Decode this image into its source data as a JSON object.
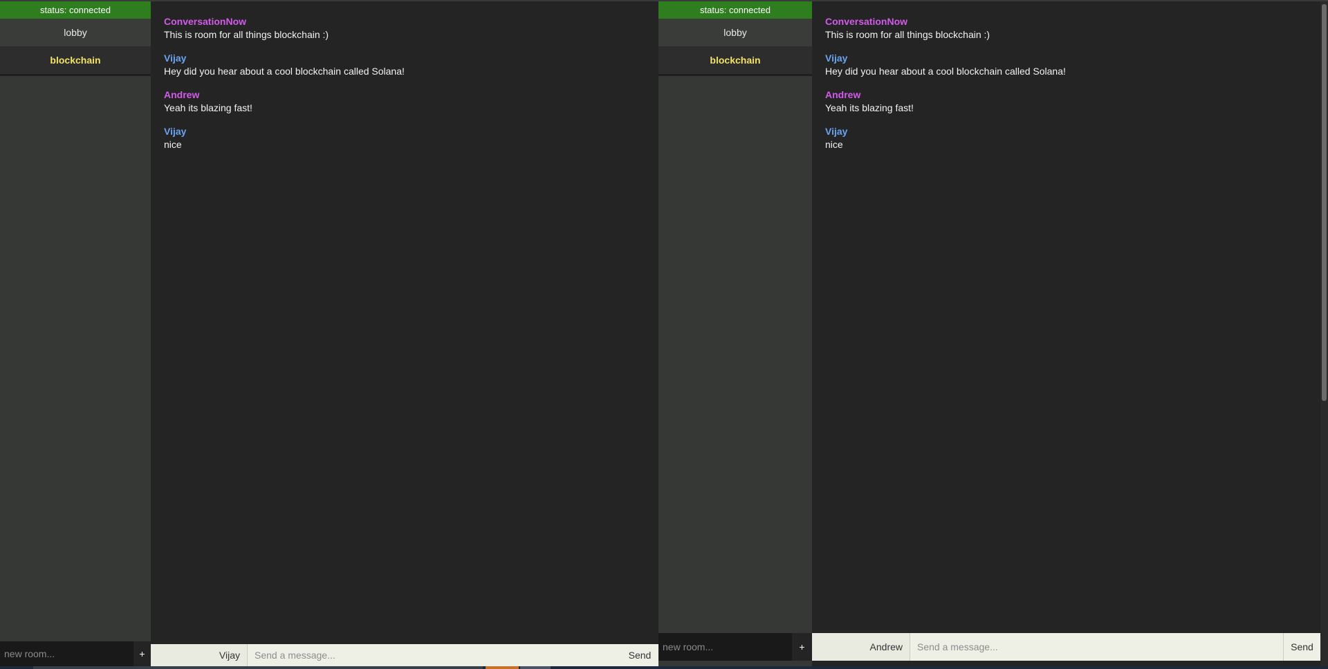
{
  "panes": {
    "left": {
      "status": "status: connected",
      "rooms": [
        {
          "label": "lobby",
          "active": false
        },
        {
          "label": "blockchain",
          "active": true
        }
      ],
      "new_room_placeholder": "new room...",
      "add_room_label": "+",
      "messages": [
        {
          "sender": "ConversationNow",
          "text": "This is room for all things blockchain :)",
          "color": "#d35bea"
        },
        {
          "sender": "Vijay",
          "text": "Hey did you hear about a cool blockchain called Solana!",
          "color": "#6aa4f2"
        },
        {
          "sender": "Andrew",
          "text": "Yeah its blazing fast!",
          "color": "#d35bea"
        },
        {
          "sender": "Vijay",
          "text": "nice",
          "color": "#6aa4f2"
        }
      ],
      "username": "Vijay",
      "message_placeholder": "Send a message...",
      "send_label": "Send"
    },
    "right": {
      "status": "status: connected",
      "rooms": [
        {
          "label": "lobby",
          "active": false
        },
        {
          "label": "blockchain",
          "active": true
        }
      ],
      "new_room_placeholder": "new room...",
      "add_room_label": "+",
      "messages": [
        {
          "sender": "ConversationNow",
          "text": "This is room for all things blockchain :)",
          "color": "#d35bea"
        },
        {
          "sender": "Vijay",
          "text": "Hey did you hear about a cool blockchain called Solana!",
          "color": "#6aa4f2"
        },
        {
          "sender": "Andrew",
          "text": "Yeah its blazing fast!",
          "color": "#d35bea"
        },
        {
          "sender": "Vijay",
          "text": "nice",
          "color": "#6aa4f2"
        }
      ],
      "username": "Andrew",
      "message_placeholder": "Send a message...",
      "send_label": "Send"
    }
  },
  "colors": {
    "status_bg": "#2e7d1f",
    "active_room": "#f2e26b"
  }
}
